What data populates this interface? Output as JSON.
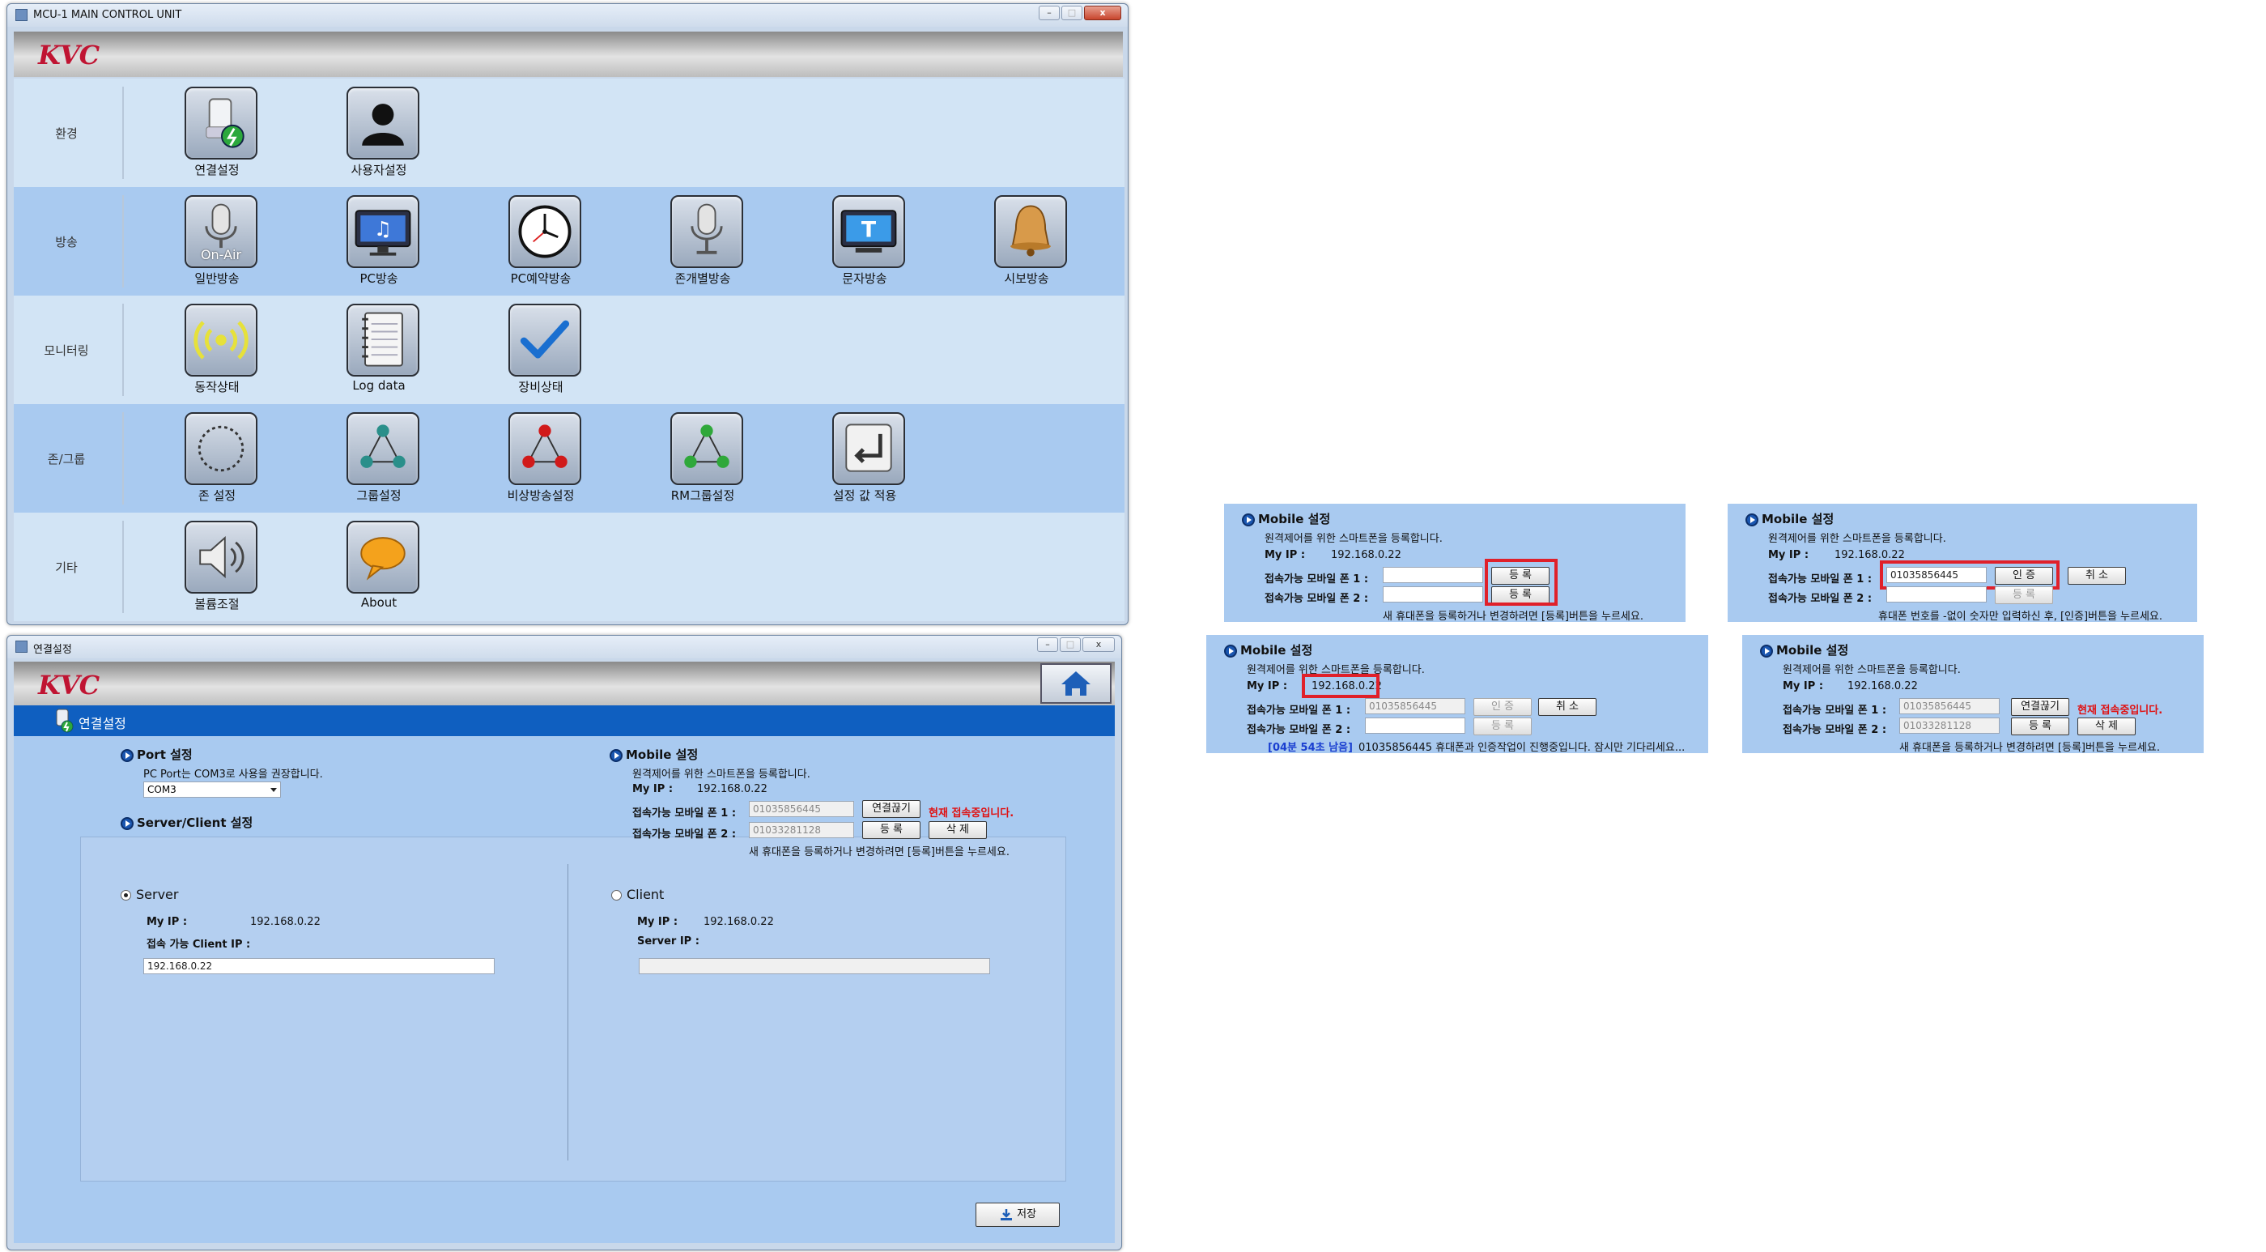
{
  "main_window": {
    "title": "MCU-1 MAIN CONTROL UNIT",
    "logo": "KVC",
    "rows": [
      {
        "label": "환경",
        "tiles": [
          {
            "label": "연결설정",
            "icon": "connection-settings-icon"
          },
          {
            "label": "사용자설정",
            "icon": "user-icon"
          }
        ]
      },
      {
        "label": "방송",
        "tiles": [
          {
            "label": "일반방송",
            "icon": "microphone-on-air-icon",
            "overlay": "On-Air"
          },
          {
            "label": "PC방송",
            "icon": "monitor-music-icon"
          },
          {
            "label": "PC예약방송",
            "icon": "clock-icon"
          },
          {
            "label": "존개별방송",
            "icon": "microphone-icon"
          },
          {
            "label": "문자방송",
            "icon": "monitor-text-icon"
          },
          {
            "label": "시보방송",
            "icon": "bell-icon"
          }
        ]
      },
      {
        "label": "모니터링",
        "tiles": [
          {
            "label": "동작상태",
            "icon": "signal-icon"
          },
          {
            "label": "Log data",
            "icon": "notebook-icon"
          },
          {
            "label": "장비상태",
            "icon": "checkmark-icon"
          }
        ]
      },
      {
        "label": "존/그룹",
        "tiles": [
          {
            "label": "존 설정",
            "icon": "zone-circle-icon"
          },
          {
            "label": "그룹설정",
            "icon": "group-network-icon"
          },
          {
            "label": "비상방송설정",
            "icon": "emergency-network-icon"
          },
          {
            "label": "RM그룹설정",
            "icon": "rm-network-icon"
          },
          {
            "label": "설정 값 적용",
            "icon": "apply-enter-icon"
          }
        ]
      },
      {
        "label": "기타",
        "tiles": [
          {
            "label": "볼륨조절",
            "icon": "speaker-icon"
          },
          {
            "label": "About",
            "icon": "speech-bubble-icon"
          }
        ]
      }
    ]
  },
  "settings_window": {
    "title": "연결설정",
    "logo": "KVC",
    "header": "연결설정",
    "port": {
      "title": "Port 설정",
      "desc": "PC Port는 COM3로 사용을 권장합니다.",
      "selected": "COM3"
    },
    "server_client": {
      "title": "Server/Client 설정",
      "server_label": "Server",
      "client_label": "Client",
      "my_ip_label": "My IP :",
      "my_ip": "192.168.0.22",
      "client_ip_label": "접속 가능 Client IP :",
      "client_ip_value": "192.168.0.22",
      "server_ip_label": "Server IP :",
      "server_ip_value": ""
    },
    "mobile": {
      "title": "Mobile 설정",
      "desc": "원격제어를 위한 스마트폰을 등록합니다.",
      "my_ip_label": "My IP :",
      "my_ip": "192.168.0.22",
      "phone1_label": "접속가능 모바일 폰 1 :",
      "phone1": "01035856445",
      "phone2_label": "접속가능 모바일 폰 2 :",
      "phone2": "01033281128",
      "disconnect": "연결끊기",
      "connected_status": "현재 접속중입니다.",
      "register": "등 록",
      "delete": "삭 제",
      "footer": "새 휴대폰을 등록하거나 변경하려면 [등록]버튼을 누르세요."
    },
    "save": "저장"
  },
  "snippets": {
    "title": "Mobile 설정",
    "desc": "원격제어를 위한 스마트폰을 등록합니다.",
    "my_ip_label": "My IP :",
    "my_ip": "192.168.0.22",
    "phone1_label": "접속가능 모바일 폰 1 :",
    "phone2_label": "접속가능 모바일 폰 2 :",
    "register": "등 록",
    "auth": "인 증",
    "cancel": "취 소",
    "disconnect": "연결끊기",
    "delete": "삭 제",
    "footer": "새 휴대폰을 등록하거나 변경하려면 [등록]버튼을 누르세요.",
    "auth_footer": "휴대폰 번호를 -없이 숫자만 입력하신 후, [인증]버튼을 누르세요.",
    "phone_input": "01035856445",
    "phone1": "01035856445",
    "phone2": "01033281128",
    "countdown": "[04분 54초 남음]",
    "progress_msg": "01035856445 휴대폰과 인증작업이 진행중입니다. 잠시만 기다리세요...",
    "connected_status": "현재 접속중입니다."
  }
}
